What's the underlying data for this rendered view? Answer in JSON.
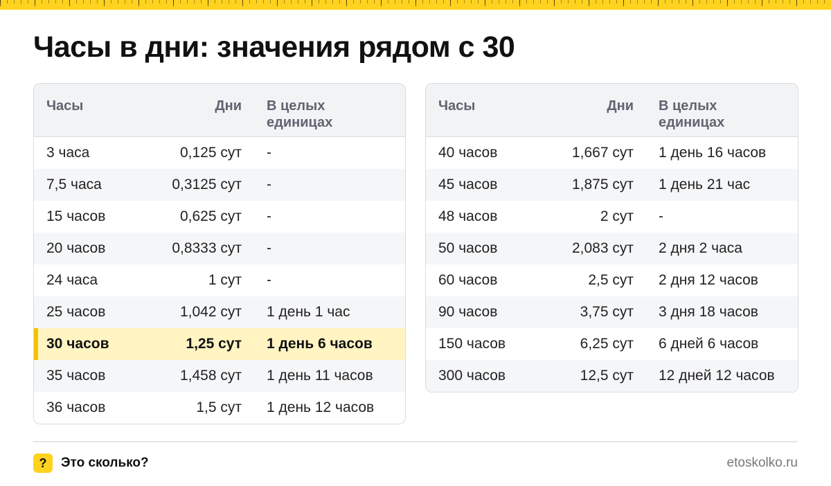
{
  "title": "Часы в дни: значения рядом с 30",
  "columns": [
    "Часы",
    "Дни",
    "В целых единицах"
  ],
  "left_table": [
    {
      "hours": "3 часа",
      "days": "0,125 сут",
      "whole": "-"
    },
    {
      "hours": "7,5 часа",
      "days": "0,3125 сут",
      "whole": "-"
    },
    {
      "hours": "15 часов",
      "days": "0,625 сут",
      "whole": "-"
    },
    {
      "hours": "20 часов",
      "days": "0,8333 сут",
      "whole": "-"
    },
    {
      "hours": "24 часа",
      "days": "1 сут",
      "whole": "-"
    },
    {
      "hours": "25 часов",
      "days": "1,042 сут",
      "whole": "1 день 1 час"
    },
    {
      "hours": "30 часов",
      "days": "1,25 сут",
      "whole": "1 день 6 часов",
      "highlight": true
    },
    {
      "hours": "35 часов",
      "days": "1,458 сут",
      "whole": "1 день 11 часов"
    },
    {
      "hours": "36 часов",
      "days": "1,5 сут",
      "whole": "1 день 12 часов"
    }
  ],
  "right_table": [
    {
      "hours": "40 часов",
      "days": "1,667 сут",
      "whole": "1 день 16 часов"
    },
    {
      "hours": "45 часов",
      "days": "1,875 сут",
      "whole": "1 день 21 час"
    },
    {
      "hours": "48 часов",
      "days": "2 сут",
      "whole": "-"
    },
    {
      "hours": "50 часов",
      "days": "2,083 сут",
      "whole": "2 дня 2 часа"
    },
    {
      "hours": "60 часов",
      "days": "2,5 сут",
      "whole": "2 дня 12 часов"
    },
    {
      "hours": "90 часов",
      "days": "3,75 сут",
      "whole": "3 дня 18 часов"
    },
    {
      "hours": "150 часов",
      "days": "6,25 сут",
      "whole": "6 дней 6 часов"
    },
    {
      "hours": "300 часов",
      "days": "12,5 сут",
      "whole": "12 дней 12 часов"
    }
  ],
  "footer": {
    "logo_glyph": "?",
    "brand": "Это сколько?",
    "site": "etoskolko.ru"
  },
  "colors": {
    "accent": "#ffd21f",
    "highlight_row": "#fff4c2",
    "highlight_bar": "#f2c200"
  }
}
